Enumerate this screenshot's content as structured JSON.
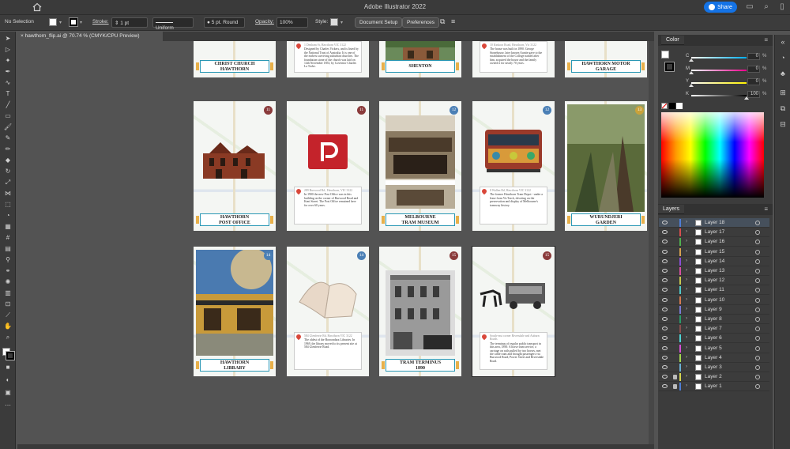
{
  "titlebar": {
    "title": "Adobe Illustrator 2022",
    "share": "Share"
  },
  "control": {
    "selection": "No Selection",
    "stroke_label": "Stroke:",
    "stroke_weight": "1 pt",
    "profile": "Uniform",
    "brush": "5 pt. Round",
    "opacity_label": "Opacity:",
    "opacity": "100%",
    "style_label": "Style:",
    "doc_setup": "Document Setup",
    "preferences": "Preferences"
  },
  "tab": {
    "name": "hawthorn_flip.ai @ 70.74 % (CMYK/CPU Preview)",
    "close": "×"
  },
  "cards": {
    "r1c1": {
      "title1": "CHRIST CHURCH",
      "title2": "HAWTHORN"
    },
    "r1c2": {
      "addr": "1 Denham St, Hawthorn VIC 3122",
      "text": "Designed by Charles Vickers, and is listed by the National Trust of Australia. It is one of the earliest surviving suburban churches. The foundation stone of the church was laid on 14th November 1853, by Governor Charles La Trobe."
    },
    "r1c3": {
      "title1": "SHENTON"
    },
    "r1c4": {
      "addr": "10 Kinkora Road, Hawthorn, Vic 3122",
      "text": "The house was built in 1890. George Stonehouse, later known Auntie gave to the establishment of the College named after him, acquired the house and the family owned it for nearly 70 years."
    },
    "r1c5": {
      "title1": "HAWTHORN MOTOR",
      "title2": "GARAGE"
    },
    "r2c1": {
      "num": "11",
      "title1": "HAWTHORN",
      "title2": "POST OFFICE"
    },
    "r2c2": {
      "num": "11",
      "addr": "289 Burwood Rd., Hawthorn, VIC 3122",
      "text": "In 1900 the new Post Office was in this building on the corner of Burwood Road and Kent Street. The Post Office remained here for over 60 years."
    },
    "r2c3": {
      "num": "12",
      "title1": "MELBOURNE",
      "title2": "TRAM MUSEUM"
    },
    "r2c4": {
      "num": "12",
      "addr": "8 Wallen Rd, Hawthorn VIC 3122",
      "text": "The former Hawthorn Tram Depot - under a lease from VicTrack, devoting on the preservation and display of Melbourne's tramway history."
    },
    "r2c5": {
      "num": "13",
      "title1": "WURUNDJERI",
      "title2": "GARDEN"
    },
    "r3c1": {
      "num": "14",
      "title1": "HAWTHORN",
      "title2": "LIBRARY"
    },
    "r3c2": {
      "num": "14",
      "addr": "584 Glenferrie Rd, Hawthorn VIC 3122",
      "text": "The oldest of the Boroondara Libraries. In 1969, the library moved to its present site at 584 Glenferrie Road."
    },
    "r3c3": {
      "num": "15",
      "title1": "TRAM TERMINUS",
      "title2": "1890"
    },
    "r3c4": {
      "num": "15",
      "addr": "South-east corner Riversdale and Auburn Roads",
      "text": "The terminus of regular public transport in this area, 1890. A horse tram service, a carriage on rails pulled by two horses, met the cable tram and brought passengers via Burwood Road, Power Street and Riversdale Road."
    }
  },
  "color_panel": {
    "tab": "Color",
    "rows": [
      {
        "label": "C",
        "value": "0",
        "unit": "%"
      },
      {
        "label": "M",
        "value": "0",
        "unit": "%"
      },
      {
        "label": "Y",
        "value": "0",
        "unit": "%"
      },
      {
        "label": "K",
        "value": "100",
        "unit": "%"
      }
    ]
  },
  "layers_panel": {
    "tab": "Layers",
    "layers": [
      {
        "name": "Layer 18",
        "color": "#4f7fd6"
      },
      {
        "name": "Layer 17",
        "color": "#d64f4f"
      },
      {
        "name": "Layer 16",
        "color": "#4fb04f"
      },
      {
        "name": "Layer 15",
        "color": "#d6a24f"
      },
      {
        "name": "Layer 14",
        "color": "#8a4fd6"
      },
      {
        "name": "Layer 13",
        "color": "#d64fa2"
      },
      {
        "name": "Layer 12",
        "color": "#c8c84f"
      },
      {
        "name": "Layer 11",
        "color": "#4fc8c8"
      },
      {
        "name": "Layer 10",
        "color": "#d67a4f"
      },
      {
        "name": "Layer 9",
        "color": "#7a7ad6"
      },
      {
        "name": "Layer 8",
        "color": "#2a9a6a"
      },
      {
        "name": "Layer 7",
        "color": "#8a4f4f"
      },
      {
        "name": "Layer 6",
        "color": "#4fd6d6"
      },
      {
        "name": "Layer 5",
        "color": "#d64fd6"
      },
      {
        "name": "Layer 4",
        "color": "#a2d64f"
      },
      {
        "name": "Layer 3",
        "color": "#6ab0d6"
      },
      {
        "name": "Layer 2",
        "color": "#d6d64f"
      },
      {
        "name": "Layer 1",
        "color": "#4f7fd6"
      }
    ]
  }
}
